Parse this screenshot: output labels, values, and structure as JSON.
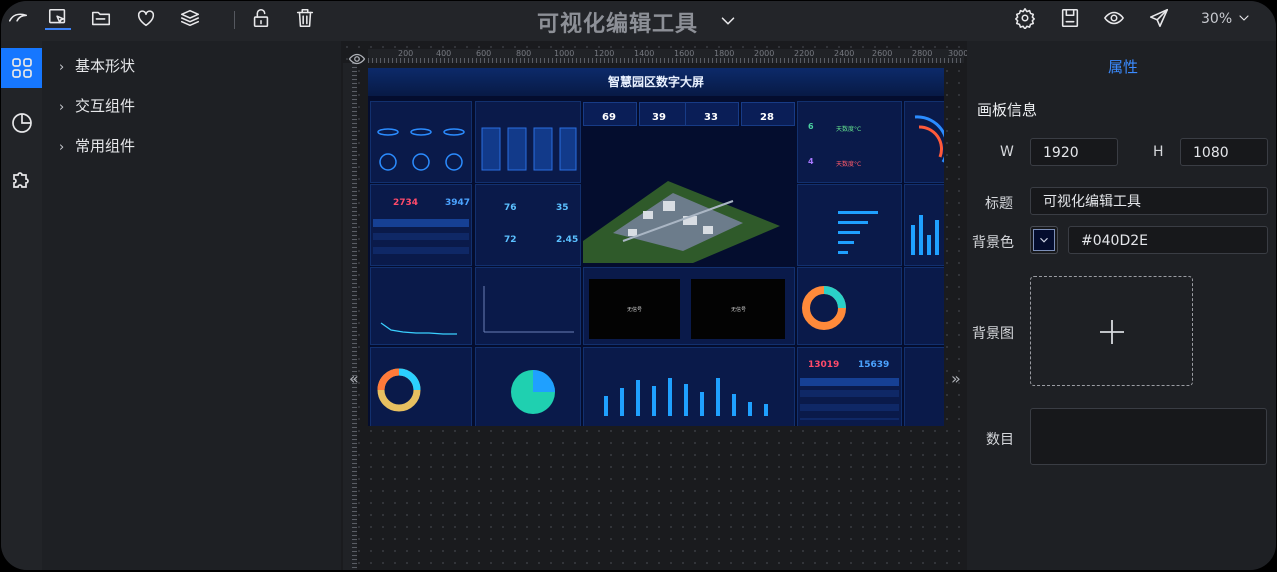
{
  "app": {
    "title": "可视化编辑工具",
    "zoom": "30%"
  },
  "toolbar": {
    "left_icons": [
      "select-icon",
      "folder-icon",
      "heart-icon",
      "layers-icon",
      "unlock-icon",
      "trash-icon"
    ],
    "right_icons": [
      "gear-icon",
      "save-icon",
      "eye-icon",
      "send-icon"
    ]
  },
  "rail": {
    "items": [
      "grid-icon",
      "chart-icon",
      "puzzle-icon"
    ],
    "active": 0
  },
  "components": {
    "items": [
      {
        "label": "基本形状"
      },
      {
        "label": "交互组件"
      },
      {
        "label": "常用组件"
      }
    ]
  },
  "ruler": {
    "ticks": [
      "200",
      "400",
      "600",
      "800",
      "1000",
      "1200",
      "1400",
      "1600",
      "1800",
      "2000",
      "2200",
      "2400",
      "2600",
      "2800",
      "3000"
    ]
  },
  "dashboard": {
    "title": "智慧园区数字大屏",
    "kpis": [
      {
        "value": "69"
      },
      {
        "value": "39"
      },
      {
        "value": "33"
      },
      {
        "value": "28"
      }
    ],
    "pair1": {
      "red": "2734",
      "blue": "3947"
    },
    "pair2": {
      "red": "13019",
      "blue": "15639"
    },
    "stats": [
      {
        "value": "76"
      },
      {
        "value": "35"
      },
      {
        "value": "72"
      },
      {
        "value": "2.45"
      }
    ],
    "weather": [
      {
        "value": "6",
        "text": "天数度°C"
      },
      {
        "value": "4",
        "text": "天数度°C"
      }
    ],
    "black_labels": [
      "无信号",
      "无信号"
    ]
  },
  "props": {
    "tab": "属性",
    "section": "画板信息",
    "w_label": "W",
    "w_value": "1920",
    "h_label": "H",
    "h_value": "1080",
    "title_label": "标题",
    "title_value": "可视化编辑工具",
    "bg_color_label": "背景色",
    "bg_color_value": "#040D2E",
    "bg_image_label": "背景图",
    "data_label": "数目"
  },
  "colors": {
    "accent": "#1677ff",
    "canvas_bg": "#040d2e"
  }
}
